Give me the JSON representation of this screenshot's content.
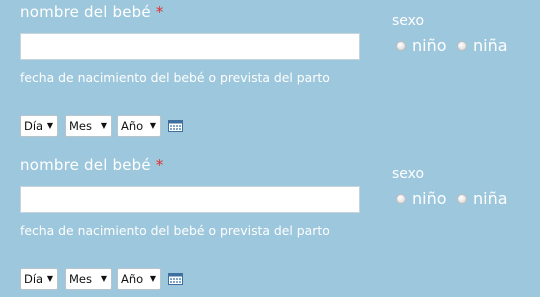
{
  "babies": [
    {
      "name_label": "nombre del bebé",
      "required_mark": "*",
      "name_value": "",
      "date_label": "fecha de nacimiento del bebé o prevista del parto",
      "day_select": "Día",
      "month_select": "Mes",
      "year_select": "Año",
      "calendar_icon": "calendar-icon",
      "sex_label": "sexo",
      "sex_options": [
        "niño",
        "niña"
      ]
    },
    {
      "name_label": "nombre del bebé",
      "required_mark": "*",
      "name_value": "",
      "date_label": "fecha de nacimiento del bebé o prevista del parto",
      "day_select": "Día",
      "month_select": "Mes",
      "year_select": "Año",
      "calendar_icon": "calendar-icon",
      "sex_label": "sexo",
      "sex_options": [
        "niño",
        "niña"
      ]
    }
  ],
  "colors": {
    "background": "#9dc7dc",
    "text": "#ffffff",
    "required": "#e0302f"
  }
}
